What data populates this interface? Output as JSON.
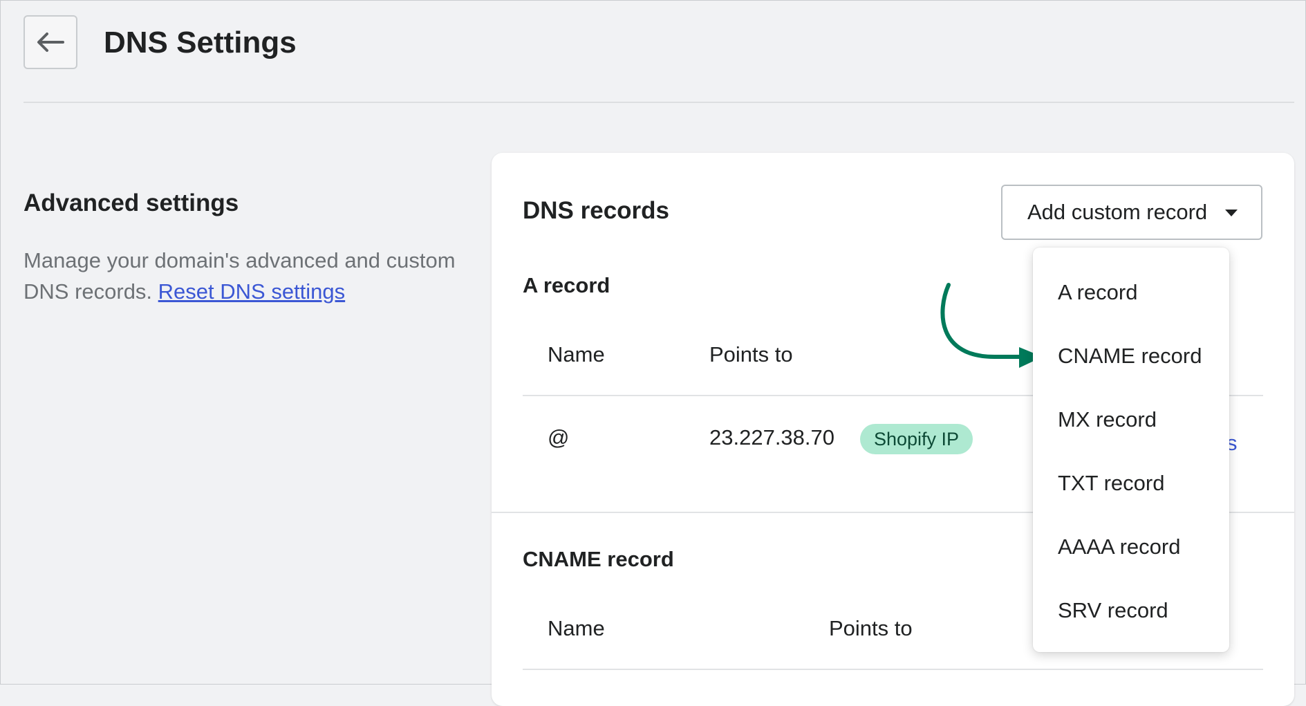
{
  "header": {
    "title": "DNS Settings"
  },
  "advanced": {
    "title": "Advanced settings",
    "description": "Manage your domain's advanced and custom DNS records.",
    "reset_link": "Reset DNS settings"
  },
  "card": {
    "title": "DNS records",
    "add_button_label": "Add custom record",
    "a_record": {
      "title": "A record",
      "columns": [
        "Name",
        "Points to"
      ],
      "row": {
        "name": "@",
        "points_to": "23.227.38.70",
        "badge": "Shopify IP",
        "action_partial": "s"
      }
    },
    "cname_record": {
      "title": "CNAME record",
      "columns": [
        "Name",
        "Points to"
      ]
    }
  },
  "dropdown": {
    "items": [
      "A record",
      "CNAME record",
      "MX record",
      "TXT record",
      "AAAA record",
      "SRV record"
    ]
  },
  "colors": {
    "badge_bg": "#aee9d1",
    "link": "#3b57d4",
    "annotation_arrow": "#007a5a"
  }
}
